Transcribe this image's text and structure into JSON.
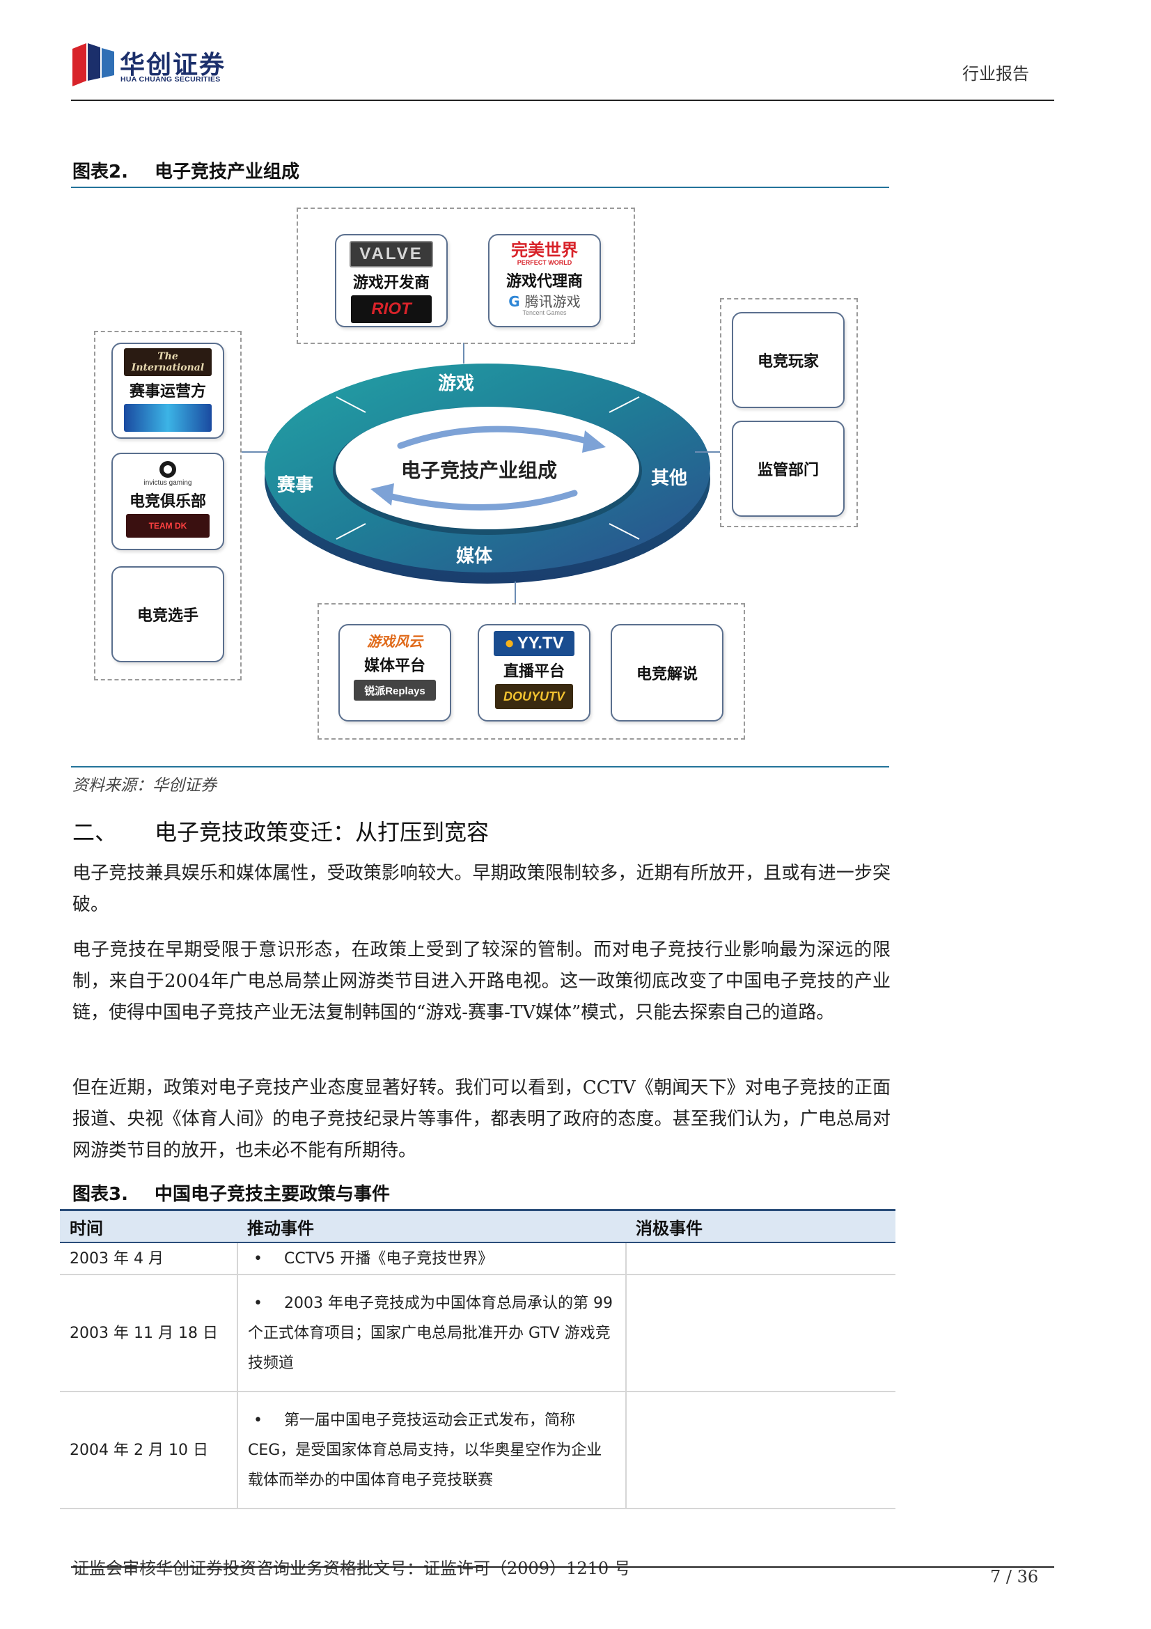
{
  "header": {
    "logo_cn": "华创证券",
    "logo_en": "HUA CHUANG SECURITIES",
    "report_type": "行业报告"
  },
  "figure2": {
    "number": "图表2.",
    "title": "电子竞技产业组成",
    "center_label": "电子竞技产业组成",
    "ring_segments": [
      "游戏",
      "赛事",
      "其他",
      "媒体"
    ],
    "top_group": [
      {
        "label": "游戏开发商",
        "logo_top": "VALVE",
        "logo_bottom": "RIOT"
      },
      {
        "label": "游戏代理商",
        "logo_top": "完美世界",
        "logo_top_sub": "PERFECT WORLD",
        "logo_bottom": "腾讯游戏",
        "logo_bottom_sub": "Tencent Games"
      }
    ],
    "left_group": [
      {
        "label": "赛事运营方",
        "logo_top": "The International"
      },
      {
        "label": "电竞俱乐部",
        "logo_top": "invictus gaming",
        "logo_bottom": "TEAM DK"
      },
      {
        "label": "电竞选手"
      }
    ],
    "right_group": [
      {
        "label": "电竞玩家"
      },
      {
        "label": "监管部门"
      }
    ],
    "bottom_group": [
      {
        "label": "媒体平台",
        "logo_top": "游戏风云",
        "logo_bottom": "锐派Replays"
      },
      {
        "label": "直播平台",
        "logo_top": "YY.TV",
        "logo_bottom": "DOUYUTV"
      },
      {
        "label": "电竞解说"
      }
    ],
    "source": "资料来源：华创证券"
  },
  "section2": {
    "number": "二、",
    "title": "电子竞技政策变迁：从打压到宽容"
  },
  "paragraphs": [
    "电子竞技兼具娱乐和媒体属性，受政策影响较大。早期政策限制较多，近期有所放开，且或有进一步突破。",
    "电子竞技在早期受限于意识形态，在政策上受到了较深的管制。而对电子竞技行业影响最为深远的限制，来自于2004年广电总局禁止网游类节目进入开路电视。这一政策彻底改变了中国电子竞技的产业链，使得中国电子竞技产业无法复制韩国的“游戏-赛事-TV媒体”模式，只能去探索自己的道路。",
    "但在近期，政策对电子竞技产业态度显著好转。我们可以看到，CCTV《朝闻天下》对电子竞技的正面报道、央视《体育人间》的电子竞技纪录片等事件，都表明了政府的态度。甚至我们认为，广电总局对网游类节目的放开，也未必不能有所期待。"
  ],
  "figure3": {
    "number": "图表3.",
    "title": "中国电子竞技主要政策与事件",
    "columns": [
      "时间",
      "推动事件",
      "消极事件"
    ],
    "rows": [
      {
        "date": "2003 年 4 月",
        "positive": "CCTV5 开播《电子竞技世界》",
        "negative": ""
      },
      {
        "date": "2003 年 11 月 18 日",
        "positive": "2003 年电子竞技成为中国体育总局承认的第 99 个正式体育项目；国家广电总局批准开办 GTV 游戏竞技频道",
        "negative": ""
      },
      {
        "date": "2004 年 2 月 10 日",
        "positive": "第一届中国电子竞技运动会正式发布，简称 CEG，是受国家体育总局支持，以华奥星空作为企业载体而举办的中国体育电子竞技联赛",
        "negative": ""
      }
    ],
    "bullet": "•"
  },
  "footer": {
    "text": "证监会审核华创证券投资咨询业务资格批文号：证监许可（2009）1210 号",
    "page": "7 / 36"
  },
  "colors": {
    "brand_navy": "#1b2f6b",
    "brand_red": "#d8232a",
    "ring_teal": "#1e8a93",
    "ring_blue": "#2a4f8f",
    "table_header_bg": "#dce7f3"
  }
}
